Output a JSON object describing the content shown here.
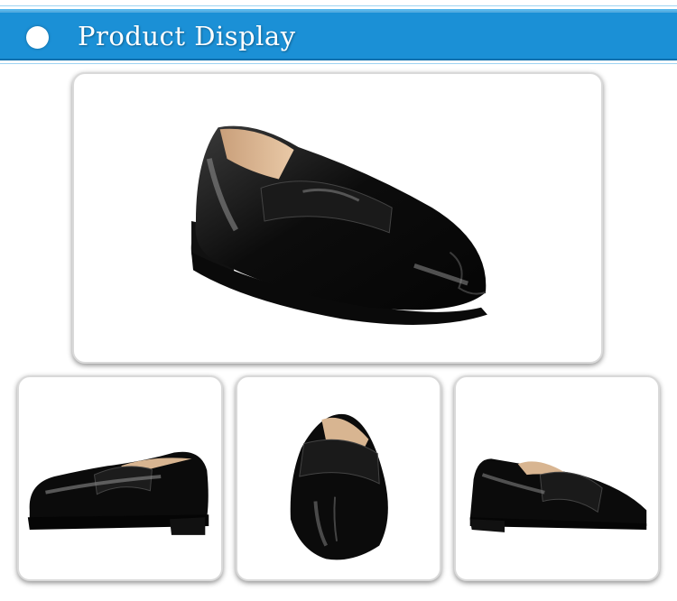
{
  "header": {
    "title": "Product Display",
    "bullet_icon": "circle-bullet-icon",
    "background_color": "#1b90d6"
  },
  "gallery": {
    "main_image": {
      "subject": "black-patent-split-toe-loafer"
    },
    "thumbnails": [
      {
        "view": "side"
      },
      {
        "view": "front"
      },
      {
        "view": "angled"
      }
    ]
  }
}
